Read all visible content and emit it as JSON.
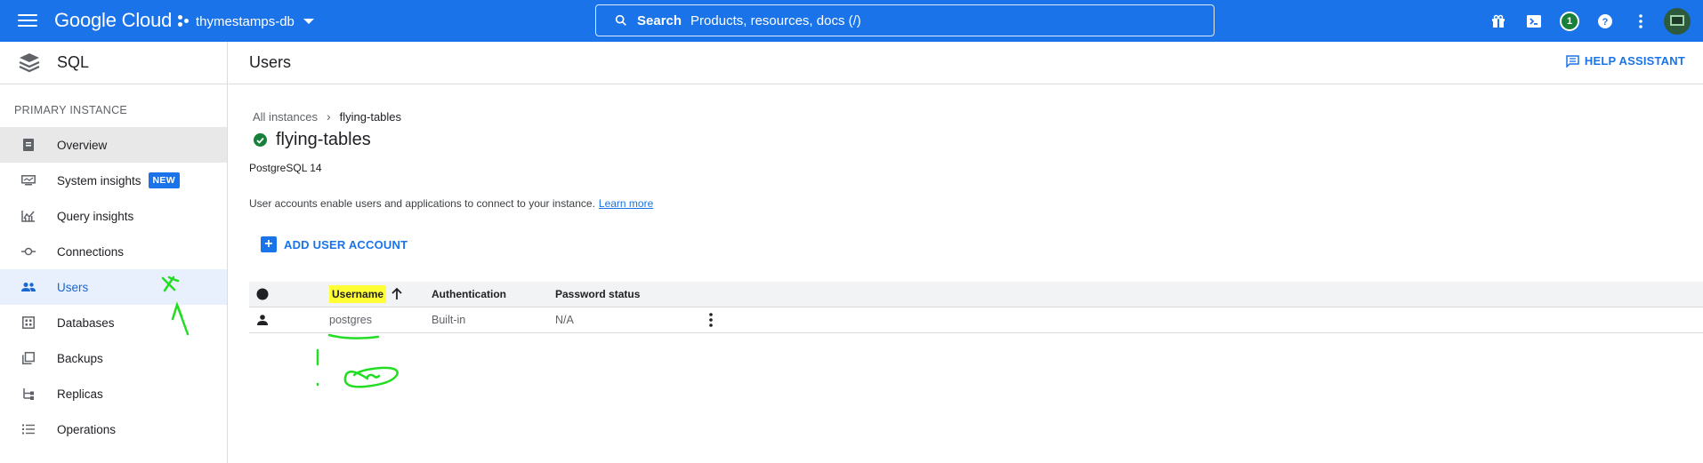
{
  "topbar": {
    "brand": "Google Cloud",
    "project": "thymestamps-db",
    "search_label": "Search",
    "search_placeholder": "Products, resources, docs (/)",
    "notification_count": "1",
    "accent": "#1a73e8"
  },
  "leftnav": {
    "product": "SQL",
    "section": "PRIMARY INSTANCE",
    "items": [
      {
        "label": "Overview",
        "icon": "overview-icon"
      },
      {
        "label": "System insights",
        "icon": "system-insights-icon",
        "badge": "NEW"
      },
      {
        "label": "Query insights",
        "icon": "query-insights-icon"
      },
      {
        "label": "Connections",
        "icon": "connections-icon"
      },
      {
        "label": "Users",
        "icon": "users-icon"
      },
      {
        "label": "Databases",
        "icon": "databases-icon"
      },
      {
        "label": "Backups",
        "icon": "backups-icon"
      },
      {
        "label": "Replicas",
        "icon": "replicas-icon"
      },
      {
        "label": "Operations",
        "icon": "operations-icon"
      }
    ]
  },
  "main": {
    "title": "Users",
    "help_assistant": "HELP ASSISTANT",
    "breadcrumb": {
      "parent": "All instances",
      "current": "flying-tables"
    },
    "instance_name": "flying-tables",
    "db_version": "PostgreSQL 14",
    "intro": "User accounts enable users and applications to connect to your instance.",
    "learn_more": "Learn more",
    "add_user": "ADD USER ACCOUNT",
    "table": {
      "columns": [
        "Username",
        "Authentication",
        "Password status"
      ],
      "rows": [
        {
          "username": "postgres",
          "authentication": "Built-in",
          "password_status": "N/A"
        }
      ]
    }
  }
}
